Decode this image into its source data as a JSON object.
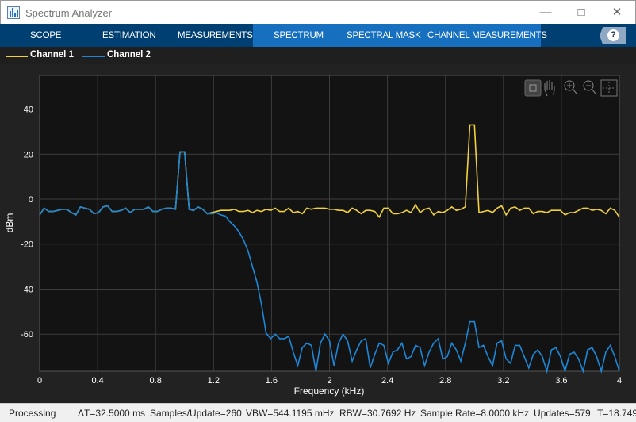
{
  "window": {
    "title": "Spectrum Analyzer",
    "app_icon": "spectrum-chart-icon",
    "controls": [
      "minimize-icon",
      "maximize-icon",
      "close-icon"
    ]
  },
  "toolbar": {
    "tabs": [
      {
        "label": "SCOPE"
      },
      {
        "label": "ESTIMATION"
      },
      {
        "label": "MEASUREMENTS"
      },
      {
        "label": "SPECTRUM",
        "active": true
      },
      {
        "label": "SPECTRAL MASK"
      },
      {
        "label": "CHANNEL MEASUREMENTS"
      }
    ],
    "help_label": "?",
    "colors": {
      "bar": "#003f72",
      "active": "#1670bf"
    }
  },
  "legend": [
    {
      "name": "Channel 1",
      "color": "#f2d23a"
    },
    {
      "name": "Channel 2",
      "color": "#1d87d8"
    }
  ],
  "plot_tools": [
    "data-cursor-icon",
    "pan-hand-icon",
    "zoom-in-icon",
    "zoom-out-icon",
    "fit-to-view-icon"
  ],
  "chart_data": {
    "type": "line",
    "xlabel": "Frequency (kHz)",
    "ylabel": "dBm",
    "xlim": [
      0,
      4
    ],
    "ylim": [
      -76.5,
      55
    ],
    "xticks": [
      "0",
      "0.4",
      "0.8",
      "1.2",
      "1.6",
      "2",
      "2.4",
      "2.8",
      "3.2",
      "3.6",
      "4"
    ],
    "yticks": [
      "40",
      "20",
      "0",
      "-20",
      "-40",
      "-60"
    ],
    "ytick_values": [
      40,
      20,
      0,
      -20,
      -40,
      -60
    ],
    "grid": true,
    "x_step_khz": 0.03125,
    "series": [
      {
        "name": "Channel 1",
        "color": "#f2d23a",
        "values": [
          -7,
          -4,
          -5.5,
          -5.5,
          -5,
          -4.5,
          -4.5,
          -6,
          -7,
          -3.5,
          -4,
          -4.5,
          -6.5,
          -6,
          -3.5,
          -3,
          -5.5,
          -5.5,
          -5,
          -4,
          -6,
          -4.5,
          -4.5,
          -4.5,
          -3.5,
          -5.5,
          -5.5,
          -4.5,
          -4,
          -4,
          -4.5,
          21,
          21,
          -4.5,
          -5,
          -3.5,
          -4.5,
          -6.5,
          -6,
          -5.5,
          -5,
          -5,
          -5,
          -4.5,
          -5.5,
          -5.5,
          -5,
          -6,
          -5,
          -5.5,
          -4.5,
          -5,
          -4,
          -5.5,
          -5.5,
          -4,
          -6,
          -5.5,
          -6.5,
          -4,
          -4.5,
          -4,
          -4,
          -4,
          -4.5,
          -4.5,
          -5,
          -5,
          -6,
          -4,
          -5,
          -6.5,
          -5,
          -5,
          -5.5,
          -8,
          -4,
          -4,
          -6.5,
          -6.5,
          -6,
          -5,
          -6,
          -2.5,
          -6,
          -4.5,
          -4,
          -7,
          -5.5,
          -6,
          -5,
          -3.5,
          -5,
          -4.5,
          -3.5,
          33,
          33,
          -6,
          -5.5,
          -5,
          -6,
          -4,
          -3,
          -7,
          -4,
          -3.5,
          -5,
          -4,
          -4,
          -6.5,
          -5.5,
          -5.5,
          -6,
          -5,
          -5,
          -5,
          -7,
          -6,
          -6,
          -5,
          -4,
          -4,
          -5,
          -4.5,
          -5,
          -6.5,
          -4,
          -5,
          -8
        ]
      },
      {
        "name": "Channel 2",
        "color": "#1d87d8",
        "values": [
          -7,
          -4,
          -5.5,
          -5.5,
          -5,
          -4.5,
          -4.5,
          -6,
          -7,
          -3.5,
          -4,
          -4.5,
          -6.5,
          -6,
          -3.5,
          -3,
          -5.5,
          -5.5,
          -5,
          -4,
          -6,
          -4.5,
          -4.5,
          -4.5,
          -3.5,
          -5.5,
          -5.5,
          -4.5,
          -4,
          -4,
          -4.5,
          21,
          21,
          -4.5,
          -5,
          -3.5,
          -4.5,
          -6.5,
          -6.5,
          -6,
          -7,
          -7.5,
          -10,
          -12,
          -14.5,
          -18,
          -23,
          -30,
          -37,
          -47,
          -59.5,
          -62,
          -60,
          -62,
          -62,
          -61,
          -68,
          -74,
          -66,
          -64,
          -65,
          -76.5,
          -64,
          -60,
          -63,
          -74,
          -64,
          -60,
          -63,
          -72,
          -67,
          -63,
          -62,
          -75,
          -69,
          -64,
          -65,
          -73,
          -68,
          -67,
          -64,
          -71,
          -70,
          -65,
          -66,
          -74,
          -68,
          -64,
          -62,
          -71,
          -70,
          -64,
          -67,
          -72,
          -64,
          -54.5,
          -54.5,
          -66,
          -65,
          -70,
          -74,
          -64,
          -63,
          -71,
          -73,
          -65,
          -65,
          -70,
          -75,
          -69,
          -67,
          -70,
          -76.5,
          -67,
          -66,
          -70,
          -76.5,
          -69,
          -68,
          -71,
          -76.5,
          -67,
          -66,
          -70,
          -76.5,
          -68,
          -65,
          -70,
          -76.5
        ]
      }
    ]
  },
  "status": {
    "state": "Processing",
    "delta_t": "ΔT=32.5000 ms",
    "samples": "Samples/Update=260",
    "vbw": "VBW=544.1195 mHz",
    "rbw": "RBW=30.7692 Hz",
    "sample_rate": "Sample Rate=8.0000 kHz",
    "updates": "Updates=579",
    "time": "T=18.749"
  }
}
